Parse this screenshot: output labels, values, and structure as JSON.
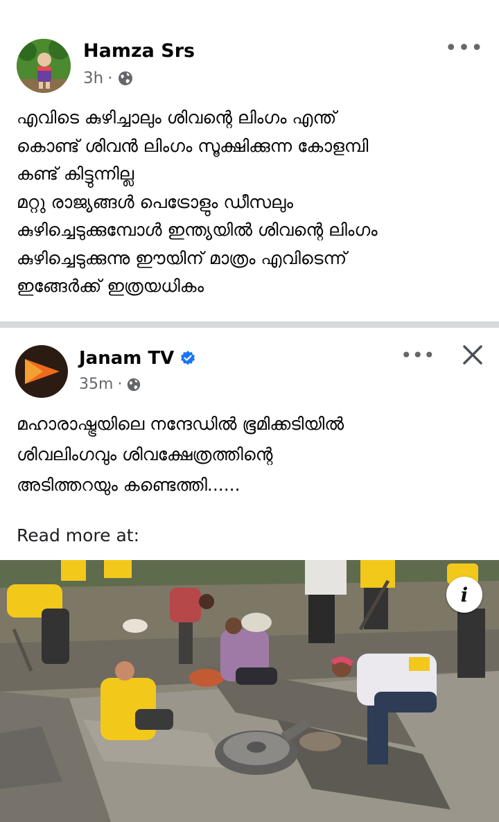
{
  "post": {
    "author": "Hamza Srs",
    "time": "3h",
    "separator": "·",
    "more_label": "•••",
    "lines": [
      "എവിടെ കുഴിച്ചാലും ശിവന്റെ ലിംഗം എന്ത്",
      "കൊണ്ട് ശിവൻ ലിംഗം സൂക്ഷിക്കുന്ന കോളമ്പി",
      "കണ്ട് കിട്ടുന്നില്ല",
      "മറ്റു രാജ്യങ്ങൾ പെട്രോളും ഡീസലും",
      "കുഴിച്ചെടുക്കുമ്പോൾ ഇന്ത്യയിൽ ശിവന്റെ ലിംഗം",
      "കുഴിച്ചെടുക്കുന്നു ഈയിന് മാത്രം എവിടെന്ന്",
      "ഇങ്ങേർക്ക് ഇത്രയധികം"
    ]
  },
  "shared": {
    "author": "Janam TV",
    "time": "35m",
    "separator": "·",
    "more_label": "•••",
    "lines": [
      "മഹാരാഷ്ട്രയിലെ നന്ദേഡിൽ ഭൂമിക്കടിയിൽ",
      "ശിവലിംഗവും ശിവക്ഷേത്രത്തിന്റെ",
      "അടിത്തറയും കണ്ടെത്തി......"
    ],
    "read_more": "Read more at:",
    "info_label": "i"
  },
  "colors": {
    "text": "#050505",
    "meta": "#65676b",
    "verified": "#1877f2",
    "divider": "#d7d9dc",
    "shirt_yellow": "#f2c81b"
  },
  "icons": {
    "globe": "globe-icon",
    "verified": "verified-badge-icon",
    "close": "close-icon",
    "more": "more-options-icon",
    "info": "info-icon"
  }
}
